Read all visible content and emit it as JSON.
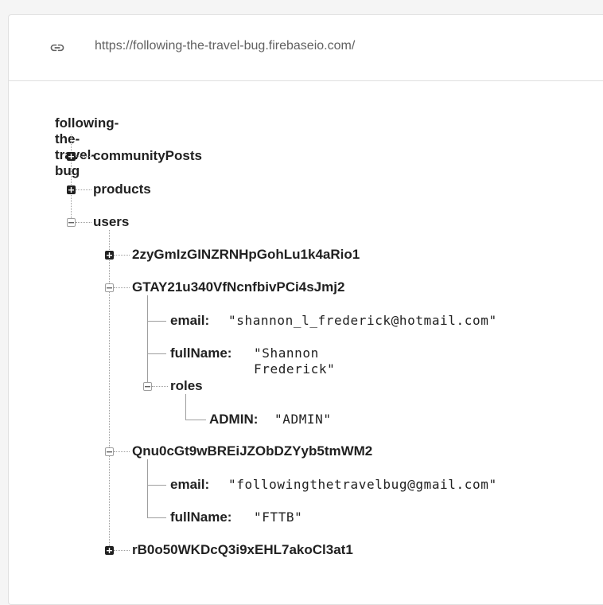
{
  "url_bar": {
    "icon": "link-icon",
    "url": "https://following-the-travel-bug.firebaseio.com/"
  },
  "tree": {
    "root": "following-the-travel-bug",
    "nodes": [
      {
        "key": "communityPosts",
        "state": "collapsed"
      },
      {
        "key": "products",
        "state": "collapsed"
      },
      {
        "key": "users",
        "state": "expanded"
      },
      {
        "key": "2zyGmIzGINZRNHpGohLu1k4aRio1",
        "state": "collapsed"
      },
      {
        "key": "GTAY21u340VfNcnfbivPCi4sJmj2",
        "state": "expanded"
      },
      {
        "key": "email:",
        "value": "\"shannon_l_frederick@hotmail.com\""
      },
      {
        "key": "fullName:",
        "value": "\"Shannon Frederick\""
      },
      {
        "key": "roles",
        "state": "expanded"
      },
      {
        "key": "ADMIN:",
        "value": "\"ADMIN\""
      },
      {
        "key": "Qnu0cGt9wBREiJZObDZYyb5tmWM2",
        "state": "expanded"
      },
      {
        "key": "email:",
        "value": "\"followingthetravelbug@gmail.com\""
      },
      {
        "key": "fullName:",
        "value": "\"FTTB\""
      },
      {
        "key": "rB0o50WKDcQ3i9xEHL7akoCl3at1",
        "state": "collapsed"
      }
    ]
  }
}
